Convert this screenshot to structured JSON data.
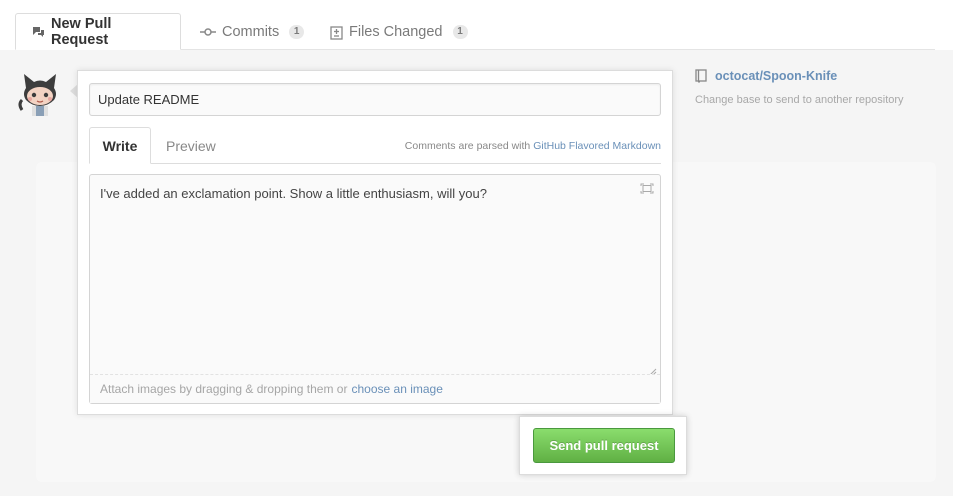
{
  "tabs": [
    {
      "label": "New Pull Request",
      "icon": "pull-request-icon"
    },
    {
      "label": "Commits",
      "icon": "commit-icon",
      "count": "1"
    },
    {
      "label": "Files Changed",
      "icon": "diff-icon",
      "count": "1"
    }
  ],
  "form": {
    "title_value": "Update README",
    "write_tab": "Write",
    "preview_tab": "Preview",
    "markdown_note": "Comments are parsed with",
    "markdown_link": "GitHub Flavored Markdown",
    "body_value": "I've added an exclamation point. Show a little enthusiasm, will you?",
    "attach_text": "Attach images by dragging & dropping them or",
    "attach_link": "choose an image",
    "submit_label": "Send pull request"
  },
  "repo": {
    "name": "octocat/Spoon-Knife",
    "subtext": "Change base to send to another repository",
    "icon": "repo-icon"
  },
  "colors": {
    "accent_link": "#6a90b8",
    "button_green": "#60b044"
  }
}
